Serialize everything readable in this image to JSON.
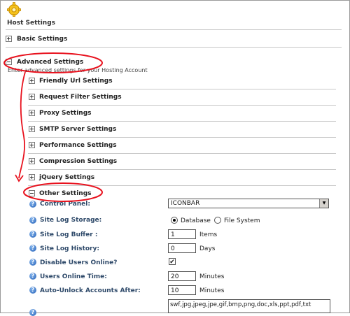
{
  "page": {
    "title": "Host Settings",
    "icon": "gear-icon"
  },
  "sections": {
    "basic": {
      "label": "Basic Settings",
      "state": "collapsed"
    },
    "advanced": {
      "label": "Advanced Settings",
      "state": "expanded",
      "description": "Enter advanced settings for your Hosting Account"
    }
  },
  "subsections": [
    {
      "label": "Friendly Url Settings",
      "state": "collapsed"
    },
    {
      "label": "Request Filter Settings",
      "state": "collapsed"
    },
    {
      "label": "Proxy Settings",
      "state": "collapsed"
    },
    {
      "label": "SMTP Server Settings",
      "state": "collapsed"
    },
    {
      "label": "Performance Settings",
      "state": "collapsed"
    },
    {
      "label": "Compression Settings",
      "state": "collapsed"
    },
    {
      "label": "jQuery Settings",
      "state": "collapsed"
    },
    {
      "label": "Other Settings",
      "state": "expanded"
    }
  ],
  "other_settings": {
    "control_panel": {
      "label": "Control Panel:",
      "value": "ICONBAR"
    },
    "site_log_storage": {
      "label": "Site Log Storage:",
      "options": [
        "Database",
        "File System"
      ],
      "selected": "Database"
    },
    "site_log_buffer": {
      "label": "Site Log Buffer :",
      "value": "1",
      "unit": "Items"
    },
    "site_log_history": {
      "label": "Site Log History:",
      "value": "0",
      "unit": "Days"
    },
    "disable_users_online": {
      "label": "Disable Users Online?",
      "checked": true
    },
    "users_online_time": {
      "label": "Users Online Time:",
      "value": "20",
      "unit": "Minutes"
    },
    "auto_unlock": {
      "label": "Auto-Unlock Accounts After:",
      "value": "10",
      "unit": "Minutes"
    },
    "file_extensions": {
      "value": "swf,jpg,jpeg,jpe,gif,bmp,png,doc,xls,ppt,pdf,txt"
    }
  },
  "colors": {
    "annotation": "#e8121e",
    "field_label": "#2f4a6a",
    "help_icon": "#2a63b8"
  }
}
